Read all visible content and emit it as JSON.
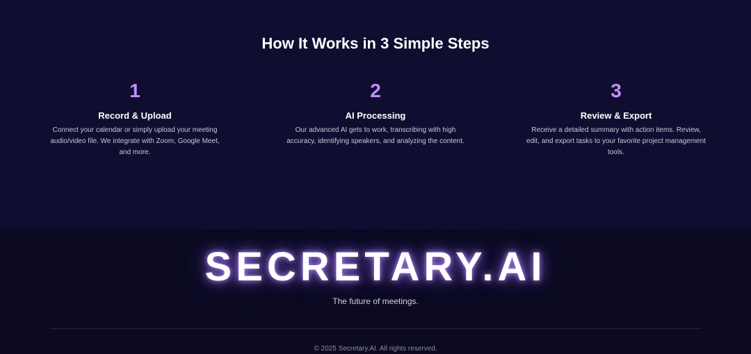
{
  "how_it_works": {
    "title": "How It Works in 3 Simple Steps",
    "steps": [
      {
        "number": "1",
        "title": "Record & Upload",
        "description": "Connect your calendar or simply upload your meeting audio/video file. We integrate with Zoom, Google Meet, and more."
      },
      {
        "number": "2",
        "title": "AI Processing",
        "description": "Our advanced AI gets to work, transcribing with high accuracy, identifying speakers, and analyzing the content."
      },
      {
        "number": "3",
        "title": "Review & Export",
        "description": "Receive a detailed summary with action items. Review, edit, and export tasks to your favorite project management tools."
      }
    ]
  },
  "footer": {
    "brand": "SECRETARY.AI",
    "tagline": "The future of meetings.",
    "copyright": "© 2025 Secretary.AI. All rights reserved."
  },
  "colors": {
    "section_background": "#100e30",
    "footer_background": "#0b0a22",
    "accent": "#c48cff"
  }
}
